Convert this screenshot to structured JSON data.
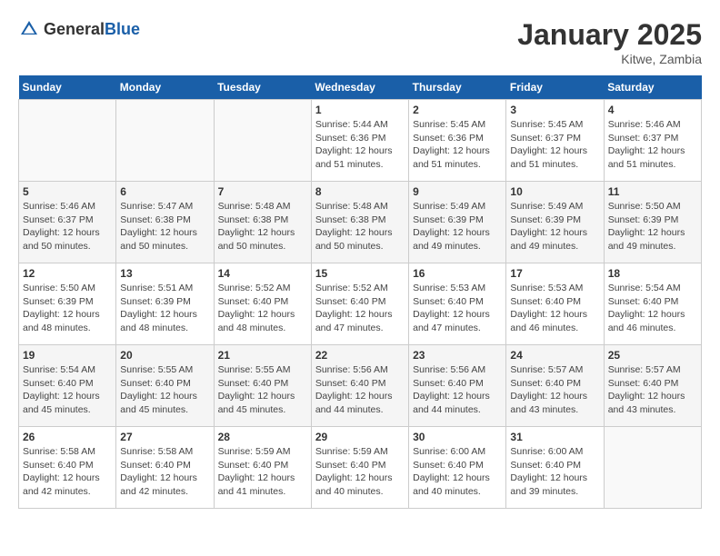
{
  "header": {
    "logo_general": "General",
    "logo_blue": "Blue",
    "month": "January 2025",
    "location": "Kitwe, Zambia"
  },
  "weekdays": [
    "Sunday",
    "Monday",
    "Tuesday",
    "Wednesday",
    "Thursday",
    "Friday",
    "Saturday"
  ],
  "weeks": [
    [
      {
        "day": "",
        "info": ""
      },
      {
        "day": "",
        "info": ""
      },
      {
        "day": "",
        "info": ""
      },
      {
        "day": "1",
        "info": "Sunrise: 5:44 AM\nSunset: 6:36 PM\nDaylight: 12 hours\nand 51 minutes."
      },
      {
        "day": "2",
        "info": "Sunrise: 5:45 AM\nSunset: 6:36 PM\nDaylight: 12 hours\nand 51 minutes."
      },
      {
        "day": "3",
        "info": "Sunrise: 5:45 AM\nSunset: 6:37 PM\nDaylight: 12 hours\nand 51 minutes."
      },
      {
        "day": "4",
        "info": "Sunrise: 5:46 AM\nSunset: 6:37 PM\nDaylight: 12 hours\nand 51 minutes."
      }
    ],
    [
      {
        "day": "5",
        "info": "Sunrise: 5:46 AM\nSunset: 6:37 PM\nDaylight: 12 hours\nand 50 minutes."
      },
      {
        "day": "6",
        "info": "Sunrise: 5:47 AM\nSunset: 6:38 PM\nDaylight: 12 hours\nand 50 minutes."
      },
      {
        "day": "7",
        "info": "Sunrise: 5:48 AM\nSunset: 6:38 PM\nDaylight: 12 hours\nand 50 minutes."
      },
      {
        "day": "8",
        "info": "Sunrise: 5:48 AM\nSunset: 6:38 PM\nDaylight: 12 hours\nand 50 minutes."
      },
      {
        "day": "9",
        "info": "Sunrise: 5:49 AM\nSunset: 6:39 PM\nDaylight: 12 hours\nand 49 minutes."
      },
      {
        "day": "10",
        "info": "Sunrise: 5:49 AM\nSunset: 6:39 PM\nDaylight: 12 hours\nand 49 minutes."
      },
      {
        "day": "11",
        "info": "Sunrise: 5:50 AM\nSunset: 6:39 PM\nDaylight: 12 hours\nand 49 minutes."
      }
    ],
    [
      {
        "day": "12",
        "info": "Sunrise: 5:50 AM\nSunset: 6:39 PM\nDaylight: 12 hours\nand 48 minutes."
      },
      {
        "day": "13",
        "info": "Sunrise: 5:51 AM\nSunset: 6:39 PM\nDaylight: 12 hours\nand 48 minutes."
      },
      {
        "day": "14",
        "info": "Sunrise: 5:52 AM\nSunset: 6:40 PM\nDaylight: 12 hours\nand 48 minutes."
      },
      {
        "day": "15",
        "info": "Sunrise: 5:52 AM\nSunset: 6:40 PM\nDaylight: 12 hours\nand 47 minutes."
      },
      {
        "day": "16",
        "info": "Sunrise: 5:53 AM\nSunset: 6:40 PM\nDaylight: 12 hours\nand 47 minutes."
      },
      {
        "day": "17",
        "info": "Sunrise: 5:53 AM\nSunset: 6:40 PM\nDaylight: 12 hours\nand 46 minutes."
      },
      {
        "day": "18",
        "info": "Sunrise: 5:54 AM\nSunset: 6:40 PM\nDaylight: 12 hours\nand 46 minutes."
      }
    ],
    [
      {
        "day": "19",
        "info": "Sunrise: 5:54 AM\nSunset: 6:40 PM\nDaylight: 12 hours\nand 45 minutes."
      },
      {
        "day": "20",
        "info": "Sunrise: 5:55 AM\nSunset: 6:40 PM\nDaylight: 12 hours\nand 45 minutes."
      },
      {
        "day": "21",
        "info": "Sunrise: 5:55 AM\nSunset: 6:40 PM\nDaylight: 12 hours\nand 45 minutes."
      },
      {
        "day": "22",
        "info": "Sunrise: 5:56 AM\nSunset: 6:40 PM\nDaylight: 12 hours\nand 44 minutes."
      },
      {
        "day": "23",
        "info": "Sunrise: 5:56 AM\nSunset: 6:40 PM\nDaylight: 12 hours\nand 44 minutes."
      },
      {
        "day": "24",
        "info": "Sunrise: 5:57 AM\nSunset: 6:40 PM\nDaylight: 12 hours\nand 43 minutes."
      },
      {
        "day": "25",
        "info": "Sunrise: 5:57 AM\nSunset: 6:40 PM\nDaylight: 12 hours\nand 43 minutes."
      }
    ],
    [
      {
        "day": "26",
        "info": "Sunrise: 5:58 AM\nSunset: 6:40 PM\nDaylight: 12 hours\nand 42 minutes."
      },
      {
        "day": "27",
        "info": "Sunrise: 5:58 AM\nSunset: 6:40 PM\nDaylight: 12 hours\nand 42 minutes."
      },
      {
        "day": "28",
        "info": "Sunrise: 5:59 AM\nSunset: 6:40 PM\nDaylight: 12 hours\nand 41 minutes."
      },
      {
        "day": "29",
        "info": "Sunrise: 5:59 AM\nSunset: 6:40 PM\nDaylight: 12 hours\nand 40 minutes."
      },
      {
        "day": "30",
        "info": "Sunrise: 6:00 AM\nSunset: 6:40 PM\nDaylight: 12 hours\nand 40 minutes."
      },
      {
        "day": "31",
        "info": "Sunrise: 6:00 AM\nSunset: 6:40 PM\nDaylight: 12 hours\nand 39 minutes."
      },
      {
        "day": "",
        "info": ""
      }
    ]
  ]
}
